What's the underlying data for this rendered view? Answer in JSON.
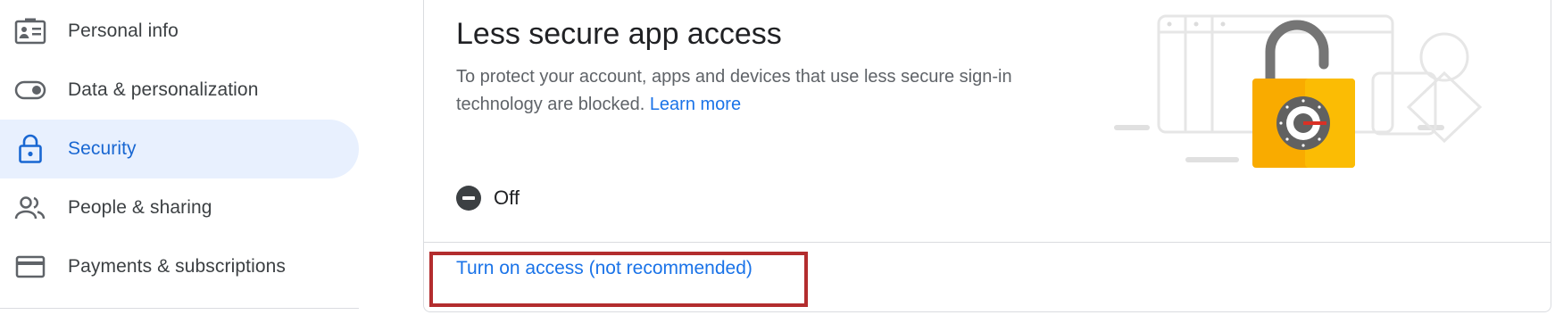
{
  "sidebar": {
    "items": [
      {
        "label": "Personal info",
        "icon": "personal-info-icon",
        "active": false
      },
      {
        "label": "Data & personalization",
        "icon": "toggle-icon",
        "active": false
      },
      {
        "label": "Security",
        "icon": "lock-icon",
        "active": true
      },
      {
        "label": "People & sharing",
        "icon": "people-icon",
        "active": false
      },
      {
        "label": "Payments & subscriptions",
        "icon": "credit-card-icon",
        "active": false
      }
    ]
  },
  "card": {
    "title": "Less secure app access",
    "description": "To protect your account, apps and devices that use less secure sign-in technology are blocked.",
    "learn_more": "Learn more",
    "status": {
      "text": "Off",
      "icon": "minus-circle-icon"
    },
    "action_label": "Turn on access (not recommended)"
  },
  "colors": {
    "accent": "#1a73e8",
    "active_bg": "#e8f0fe",
    "highlight": "#b32d2e",
    "lock": "#f9ab00"
  }
}
